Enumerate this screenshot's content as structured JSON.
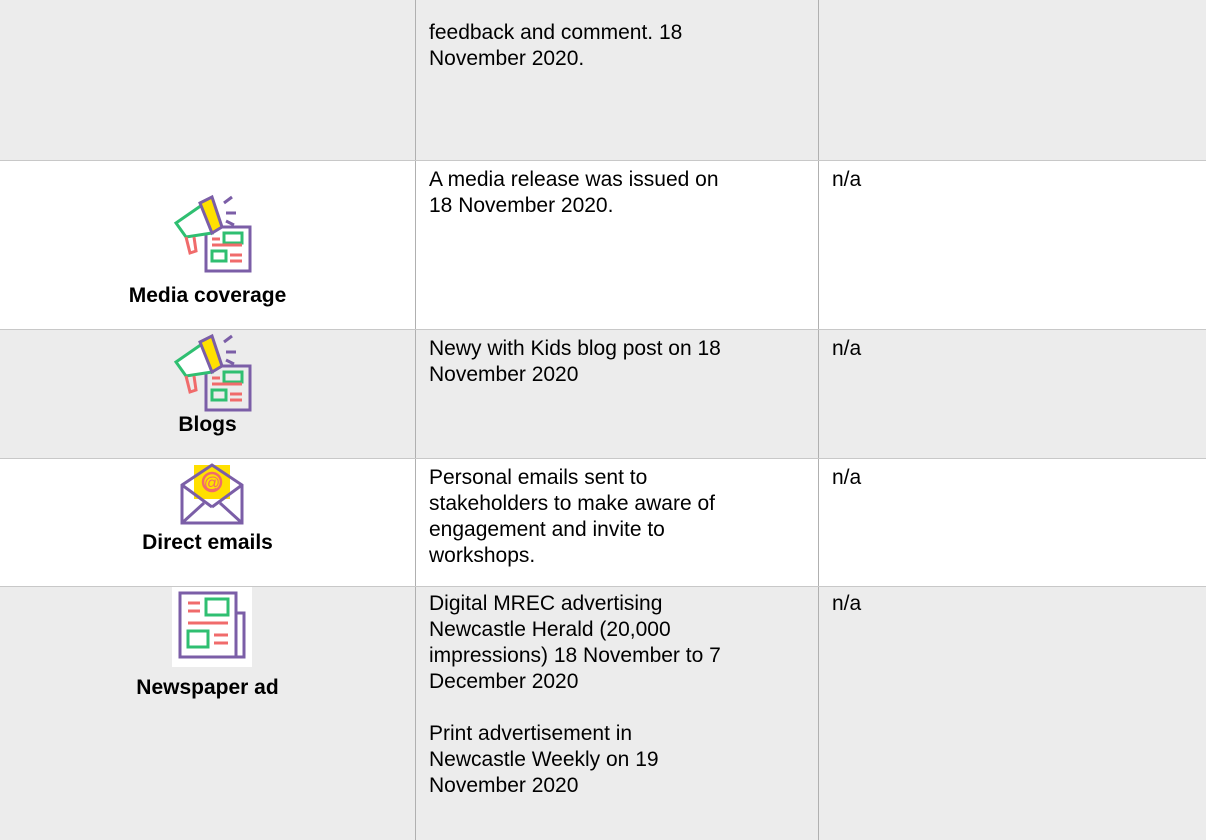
{
  "rows": [
    {
      "label": "",
      "description": "feedback and comment. 18\nNovember 2020.",
      "outcome": ""
    },
    {
      "label": "Media coverage",
      "icon": "megaphone-newspaper-icon",
      "description": "A media release was issued on\n18 November 2020.",
      "outcome": "n/a"
    },
    {
      "label": "Blogs",
      "icon": "megaphone-newspaper-icon",
      "description": "Newy with Kids blog post on 18\nNovember 2020",
      "outcome": "n/a"
    },
    {
      "label": "Direct emails",
      "icon": "envelope-at-icon",
      "description": "Personal emails sent to\nstakeholders to make aware of\nengagement and invite to\nworkshops.",
      "outcome": "n/a"
    },
    {
      "label": "Newspaper ad",
      "icon": "newspaper-icon",
      "description": "Digital MREC advertising\nNewcastle Herald (20,000\nimpressions) 18 November to 7\nDecember 2020\n\nPrint advertisement in\nNewcastle Weekly on 19\nNovember 2020",
      "outcome": "n/a"
    }
  ],
  "colors": {
    "shaded_row": "#ececec",
    "grid_line": "#b0b0b0",
    "icon_green": "#2fbf71",
    "icon_red": "#f06b6b",
    "icon_purple": "#7b5ea7",
    "icon_yellow": "#ffe000"
  }
}
